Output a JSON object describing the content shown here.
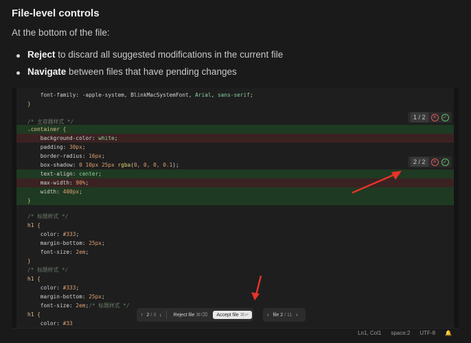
{
  "doc": {
    "title": "File-level controls",
    "intro": "At the bottom of the file:",
    "bullets": [
      {
        "bold": "Reject",
        "rest": " to discard all suggested modifications in the current file"
      },
      {
        "bold": "Navigate",
        "rest": " between files that have pending changes"
      }
    ]
  },
  "editor": {
    "hunks": [
      {
        "count": "1 / 2"
      },
      {
        "count": "2 / 2"
      }
    ],
    "bottom_bar": {
      "change_pos": "2",
      "change_total": "3",
      "reject_label": "Reject file",
      "reject_kbd": "⌘⌫",
      "accept_label": "Accept file",
      "accept_kbd": "⌘↵",
      "file_label": "file",
      "file_pos": "2",
      "file_total": "11"
    },
    "status": {
      "cursor": "Ln1, Col1",
      "spacing": "space:2",
      "encoding": "UTF-8"
    }
  },
  "colors": {
    "added_bg": "#1f3a22",
    "removed_bg": "#3b2222",
    "annotation_arrow": "#e8322a"
  }
}
